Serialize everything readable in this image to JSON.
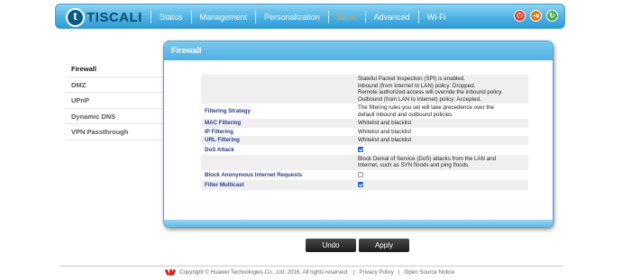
{
  "header": {
    "logo_letter": "t",
    "logo_text": "TISCALI",
    "nav": [
      "Status",
      "Management",
      "Personalization",
      "Basic",
      "Advanced",
      "Wi-Fi"
    ],
    "active_nav": "Basic",
    "icons": [
      "power-icon",
      "logout-icon",
      "refresh-icon"
    ]
  },
  "sidebar": {
    "items": [
      {
        "label": "Firewall",
        "active": true
      },
      {
        "label": "DMZ",
        "active": false
      },
      {
        "label": "UPnP",
        "active": false
      },
      {
        "label": "Dynamic DNS",
        "active": false
      },
      {
        "label": "VPN Passthrough",
        "active": false
      }
    ]
  },
  "panel": {
    "title": "Firewall",
    "rows": [
      {
        "label": "",
        "lines": [
          "Stateful Packet Inspection (SPI) is enabled.",
          "Inbound (from Internet to LAN) policy: Dropped.",
          "Remote authorized access will override the inbound policy.",
          "Outbound (from LAN to Internet) policy: Accepted."
        ],
        "checkbox": null
      },
      {
        "label": "Filtering Strategy",
        "lines": [
          "The filtering rules you set will take precedence over the",
          "default inbound and outbound policies."
        ],
        "checkbox": null
      },
      {
        "label": "MAC Filtering",
        "lines": [
          "Whitelist and blacklist"
        ],
        "checkbox": null
      },
      {
        "label": "IP Filtering",
        "lines": [
          "Whitelist and blacklist"
        ],
        "checkbox": null
      },
      {
        "label": "URL Filtering",
        "lines": [
          "Whitelist and blacklist"
        ],
        "checkbox": null
      },
      {
        "label": "DoS Attack",
        "lines": [],
        "checkbox": true
      },
      {
        "label": "",
        "lines": [
          "Block Denial of Service (DoS) attacks from the LAN and",
          "Internet, such as SYN floods and ping floods."
        ],
        "checkbox": null
      },
      {
        "label": "Block Anonymous Internet Requests",
        "lines": [],
        "checkbox": false
      },
      {
        "label": "Filter Multicast",
        "lines": [],
        "checkbox": true
      }
    ]
  },
  "buttons": {
    "undo": "Undo",
    "apply": "Apply"
  },
  "footer": {
    "copyright": "Copyright © Huawei Technologies Co., Ltd. 2016. All rights reserved.",
    "sep": "|",
    "privacy": "Privacy Policy",
    "open_source": "Open Source Notice"
  }
}
